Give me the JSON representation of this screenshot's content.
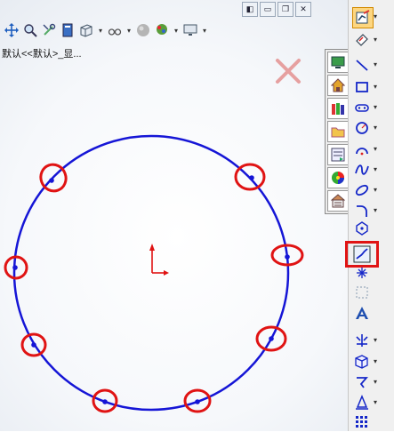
{
  "window": {
    "buttons": [
      "window-tile",
      "window-restore",
      "window-maximize",
      "window-close"
    ],
    "btn_labels": [
      "◧",
      "▭",
      "❐",
      "✕"
    ]
  },
  "toolbar": {
    "icons": [
      "move-icon",
      "zoom-icon",
      "wrench-icon",
      "notebook-icon",
      "cube-icon",
      "glasses-icon",
      "sphere-icon",
      "scene-icon",
      "monitor-icon"
    ]
  },
  "path": {
    "text": "默认<<默认>_显..."
  },
  "midbar": {
    "icons": [
      "display-icon",
      "home-icon",
      "library-icon",
      "folder-icon",
      "task-icon",
      "appearance-icon",
      "properties-icon"
    ]
  },
  "rightbar": {
    "icons": [
      "sketch-icon",
      "smart-dimension-icon",
      "line-icon",
      "rectangle-icon",
      "slot-icon",
      "circle-icon",
      "arc-icon",
      "spline-icon",
      "ellipse-icon",
      "fillet-icon",
      "plane-icon",
      "point-icon",
      "centerline-icon",
      "mirror-entities-icon",
      "text-icon",
      "offset-icon",
      "convert-entities-icon",
      "trim-icon",
      "pattern-icon",
      "grid-icon"
    ],
    "highlighted": "centerline-icon"
  },
  "colors": {
    "circle": "#1515d6",
    "highlight": "#e01313",
    "origin": "#e01313",
    "cross": "#e6a0a0"
  },
  "sketch": {
    "circle_points_count": 8,
    "circled_points": 8
  }
}
